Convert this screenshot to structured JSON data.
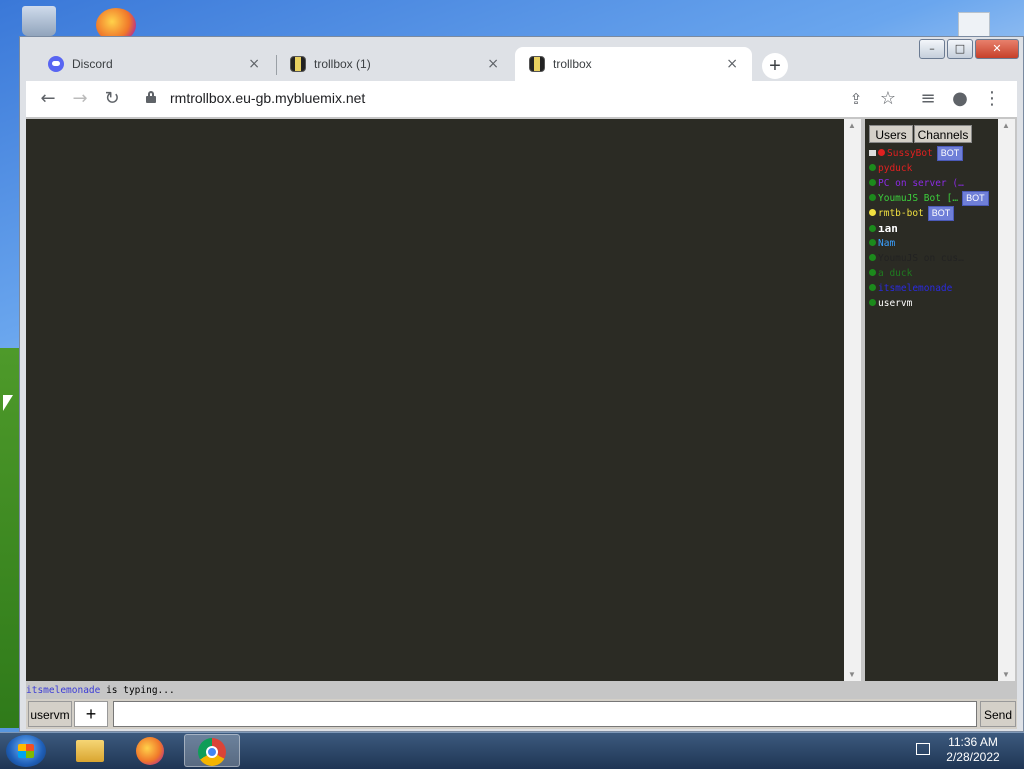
{
  "window": {
    "tabs": [
      {
        "title": "Discord",
        "icon": "discord-icon",
        "close": "×"
      },
      {
        "title": "trollbox (1)",
        "icon": "trollbox-icon",
        "close": "×"
      },
      {
        "title": "trollbox",
        "icon": "trollbox-icon",
        "close": "×",
        "active": true
      }
    ],
    "new_tab": "+",
    "controls": {
      "minimize": "–",
      "maximize": "□",
      "close": "✕"
    }
  },
  "toolbar": {
    "back": "←",
    "forward": "→",
    "reload": "↻",
    "url": "rmtrollbox.eu-gb.mybluemix.net",
    "share": "⇪",
    "star": "☆",
    "media": "≡",
    "profile": "●",
    "menu": "⋮"
  },
  "users_panel": {
    "tabs": {
      "users": "Users",
      "channels": "Channels"
    },
    "users": [
      {
        "name": "SussyBot",
        "color": "#e02020",
        "dot": "#e02020",
        "crown": true,
        "bot": "BOT"
      },
      {
        "name": "pyduck",
        "color": "#e02020",
        "dot": "#1c8a1c"
      },
      {
        "name": "PC on server (…",
        "color": "#8a2be2",
        "dot": "#1c8a1c"
      },
      {
        "name": "YoumuJS Bot […",
        "color": "#3cd03c",
        "dot": "#1c8a1c",
        "bot": "BOT"
      },
      {
        "name": "rmtb-bot",
        "color": "#f0e040",
        "dot": "#f0e040",
        "bot": "BOT"
      },
      {
        "name": "ıan",
        "color": "#ffffff",
        "dot": "#1c8a1c",
        "bold": true
      },
      {
        "name": "Nam",
        "color": "#3aa0ff",
        "dot": "#1c8a1c"
      },
      {
        "name": "YoumuJS on cus…",
        "color": "#222222",
        "dot": "#1c8a1c"
      },
      {
        "name": "a duck",
        "color": "#1f7a1f",
        "dot": "#1c8a1c"
      },
      {
        "name": "itsmelemonade",
        "color": "#2a2ae0",
        "dot": "#1c8a1c"
      },
      {
        "name": "uservm",
        "color": "#ffffff",
        "dot": "#1c8a1c"
      }
    ]
  },
  "typing": {
    "user": "itsmelemonade",
    "text": " is typing..."
  },
  "input_bar": {
    "nick": "uservm",
    "plus": "+",
    "message_value": "",
    "send": "Send"
  },
  "taskbar": {
    "apps": [
      "file-explorer-icon",
      "firefox-icon",
      "chrome-icon"
    ],
    "time": "11:36 AM",
    "date": "2/28/2022"
  }
}
